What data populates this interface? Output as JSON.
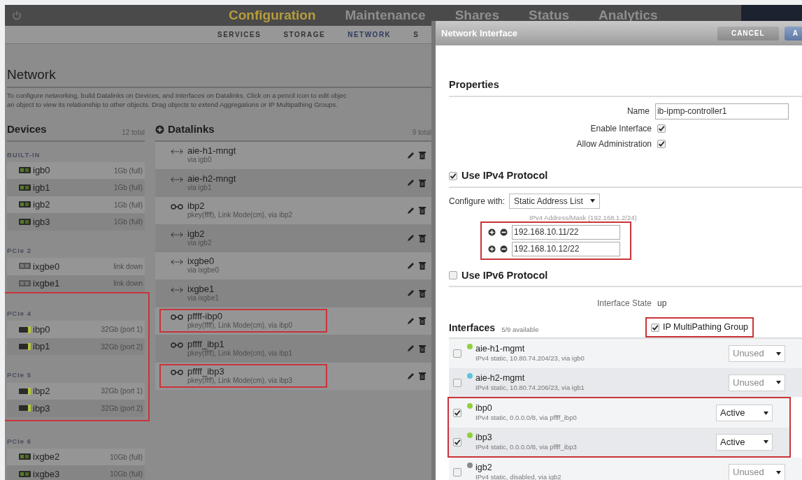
{
  "nav": {
    "tabs": [
      {
        "label": "Configuration",
        "selected": true
      },
      {
        "label": "Maintenance",
        "selected": false
      },
      {
        "label": "Shares",
        "selected": false
      },
      {
        "label": "Status",
        "selected": false
      },
      {
        "label": "Analytics",
        "selected": false
      }
    ]
  },
  "subtabs": [
    {
      "label": "SERVICES",
      "selected": false
    },
    {
      "label": "STORAGE",
      "selected": false
    },
    {
      "label": "NETWORK",
      "selected": true
    },
    {
      "label": "S",
      "selected": false
    }
  ],
  "page": {
    "title": "Network",
    "description_lines": [
      "To configure networking, build Datalinks on Devices, and Interfaces on Datalinks. Click on a pencil icon to edit objec",
      "an object to view its relationship to other objects. Drag objects to extend Aggregations or IP Multipathing Groups."
    ]
  },
  "devices": {
    "title": "Devices",
    "count": "12 total",
    "groups": [
      {
        "label": "BUILT-IN",
        "highlighted": false,
        "items": [
          {
            "name": "igb0",
            "speed": "1Gb (full)",
            "kind": "ethernet"
          },
          {
            "name": "igb1",
            "speed": "1Gb (full)",
            "kind": "ethernet"
          },
          {
            "name": "igb2",
            "speed": "1Gb (full)",
            "kind": "ethernet"
          },
          {
            "name": "igb3",
            "speed": "1Gb (full)",
            "kind": "ethernet"
          }
        ]
      },
      {
        "label": "PCIe 2",
        "highlighted": false,
        "items": [
          {
            "name": "ixgbe0",
            "speed": "link down",
            "kind": "down"
          },
          {
            "name": "ixgbe1",
            "speed": "link down",
            "kind": "down"
          }
        ]
      },
      {
        "label": "PCIe 4",
        "highlighted": true,
        "items": [
          {
            "name": "ibp0",
            "speed": "32Gb (port 1)",
            "kind": "infiniband"
          },
          {
            "name": "ibp1",
            "speed": "32Gb (port 2)",
            "kind": "infiniband"
          }
        ]
      },
      {
        "label": "PCIe 5",
        "highlighted": true,
        "items": [
          {
            "name": "ibp2",
            "speed": "32Gb (port 1)",
            "kind": "infiniband"
          },
          {
            "name": "ibp3",
            "speed": "32Gb (port 2)",
            "kind": "infiniband"
          }
        ]
      },
      {
        "label": "PCIe 6",
        "highlighted": false,
        "items": [
          {
            "name": "ixgbe2",
            "speed": "10Gb (full)",
            "kind": "ethernet"
          },
          {
            "name": "ixgbe3",
            "speed": "10Gb (full)",
            "kind": "ethernet"
          }
        ]
      }
    ]
  },
  "datalinks": {
    "title": "Datalinks",
    "count": "9 total",
    "rows": [
      {
        "kind": "vnic",
        "name": "aie-h1-mngt",
        "detail": "via igb0",
        "highlighted": false
      },
      {
        "kind": "vnic",
        "name": "aie-h2-mngt",
        "detail": "via igb1",
        "highlighted": false
      },
      {
        "kind": "partition",
        "name": "ibp2",
        "detail": "pkey(ffff), Link Mode(cm), via ibp2",
        "highlighted": false
      },
      {
        "kind": "vnic",
        "name": "igb2",
        "detail": "via igb2",
        "highlighted": false
      },
      {
        "kind": "vnic",
        "name": "ixgbe0",
        "detail": "via ixgbe0",
        "highlighted": false
      },
      {
        "kind": "vnic",
        "name": "ixgbe1",
        "detail": "via ixgbe1",
        "highlighted": false
      },
      {
        "kind": "partition",
        "name": "pffff-ibp0",
        "detail": "pkey(ffff), Link Mode(cm), via ibp0",
        "highlighted": true
      },
      {
        "kind": "partition",
        "name": "pffff_ibp1",
        "detail": "pkey(ffff), Link Mode(cm), via ibp1",
        "highlighted": false
      },
      {
        "kind": "partition",
        "name": "pffff_ibp3",
        "detail": "pkey(ffff), Link Mode(cm), via ibp3",
        "highlighted": true
      }
    ]
  },
  "dialog": {
    "title": "Network Interface",
    "buttons": [
      "CANCEL",
      "A"
    ],
    "properties": {
      "title": "Properties",
      "name_label": "Name",
      "name_value": "ib-ipmp-controller1",
      "options": [
        {
          "label": "Enable Interface",
          "checked": true
        },
        {
          "label": "Allow Administration",
          "checked": true
        }
      ]
    },
    "ipv4": {
      "label": "Use IPv4 Protocol",
      "checked": true,
      "configure_label": "Configure with:",
      "configure_value": "Static Address List",
      "address_hint": "IPv4 Address/Mask (192.168.1.2/24)",
      "addresses": [
        "192.168.10.11/22",
        "192.168.10.12/22"
      ],
      "highlighted": true
    },
    "ipv6": {
      "label": "Use IPv6 Protocol",
      "checked": false
    },
    "state": {
      "label": "Interface State",
      "value": "up"
    },
    "interfaces": {
      "title": "Interfaces",
      "available": "5/9 available",
      "ipmp": {
        "label": "IP MultiPathing Group",
        "checked": true,
        "highlighted": true
      },
      "rows": [
        {
          "name": "aie-h1-mgmt",
          "detail": "IPv4 static, 10.80.74.204/23, via igb0",
          "checked": false,
          "color": "#8fd13a",
          "role": "Unused",
          "highlighted": false
        },
        {
          "name": "aie-h2-mgmt",
          "detail": "IPv4 static, 10.80.74.206/23, via igb1",
          "checked": false,
          "color": "#5cc6d8",
          "role": "Unused",
          "highlighted": false
        },
        {
          "name": "ibp0",
          "detail": "IPv4 static, 0.0.0.0/8, via pffff_ibp0",
          "checked": true,
          "color": "#8fd13a",
          "role": "Active",
          "highlighted": true
        },
        {
          "name": "ibp3",
          "detail": "IPv4 static, 0.0.0.0/8, via pffff_ibp3",
          "checked": true,
          "color": "#8fd13a",
          "role": "Active",
          "highlighted": true
        },
        {
          "name": "igb2",
          "detail": "IPv4 static, disabled, via igb2",
          "checked": false,
          "color": "#8a8a8a",
          "role": "Unused",
          "highlighted": false
        }
      ]
    }
  }
}
